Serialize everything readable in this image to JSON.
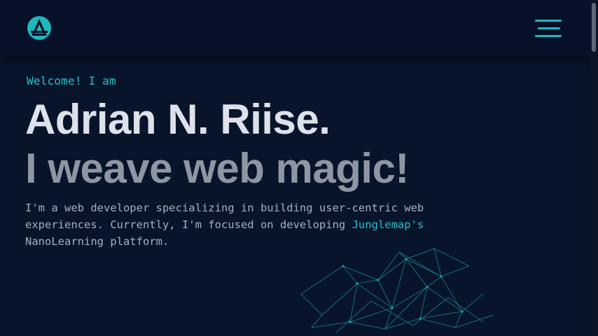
{
  "header": {
    "logo_icon": "triangle-a-logo-icon",
    "menu_icon": "hamburger-menu-icon"
  },
  "hero": {
    "welcome": "Welcome! I am",
    "name": "Adrian N. Riise.",
    "tagline": "I weave web magic!",
    "bio_line1": "I'm a web developer specializing in building user-centric web",
    "bio_line2_prefix": "experiences. Currently, I'm focused on developing ",
    "bio_link": "Junglemap's",
    "bio_line3": "NanoLearning platform."
  },
  "decoration": {
    "graph_icon": "network-graph-icon"
  },
  "colors": {
    "background": "#07142a",
    "header": "#061129",
    "accent": "#1fc4c8",
    "name_text": "#dde2ea",
    "tagline_text": "#8f96a3"
  }
}
